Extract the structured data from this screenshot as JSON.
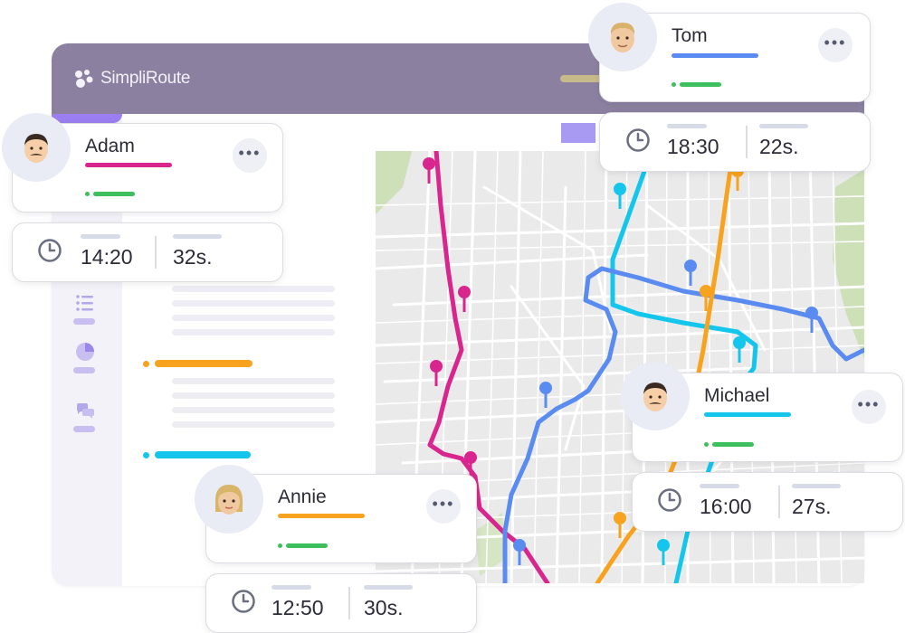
{
  "app": {
    "brand": "SimpliRoute",
    "title_bar_color": "#8b80a0"
  },
  "sidebar": {
    "items": [
      {
        "icon": "list-icon"
      },
      {
        "icon": "pie-chart-icon"
      },
      {
        "icon": "chat-bubbles-icon"
      }
    ]
  },
  "route_colors": {
    "adam": "#d9268f",
    "tom": "#5a8bf0",
    "michael": "#14c6ec",
    "annie": "#f8a31f"
  },
  "agents": {
    "adam": {
      "name": "Adam",
      "time": "14:20",
      "duration": "32s.",
      "color": "#d9268f"
    },
    "tom": {
      "name": "Tom",
      "time": "18:30",
      "duration": "22s.",
      "color": "#5a8bf0"
    },
    "michael": {
      "name": "Michael",
      "time": "16:00",
      "duration": "27s.",
      "color": "#14c6ec"
    },
    "annie": {
      "name": "Annie",
      "time": "12:50",
      "duration": "30s.",
      "color": "#f8a31f"
    }
  },
  "status_color": "#3cbf5c"
}
